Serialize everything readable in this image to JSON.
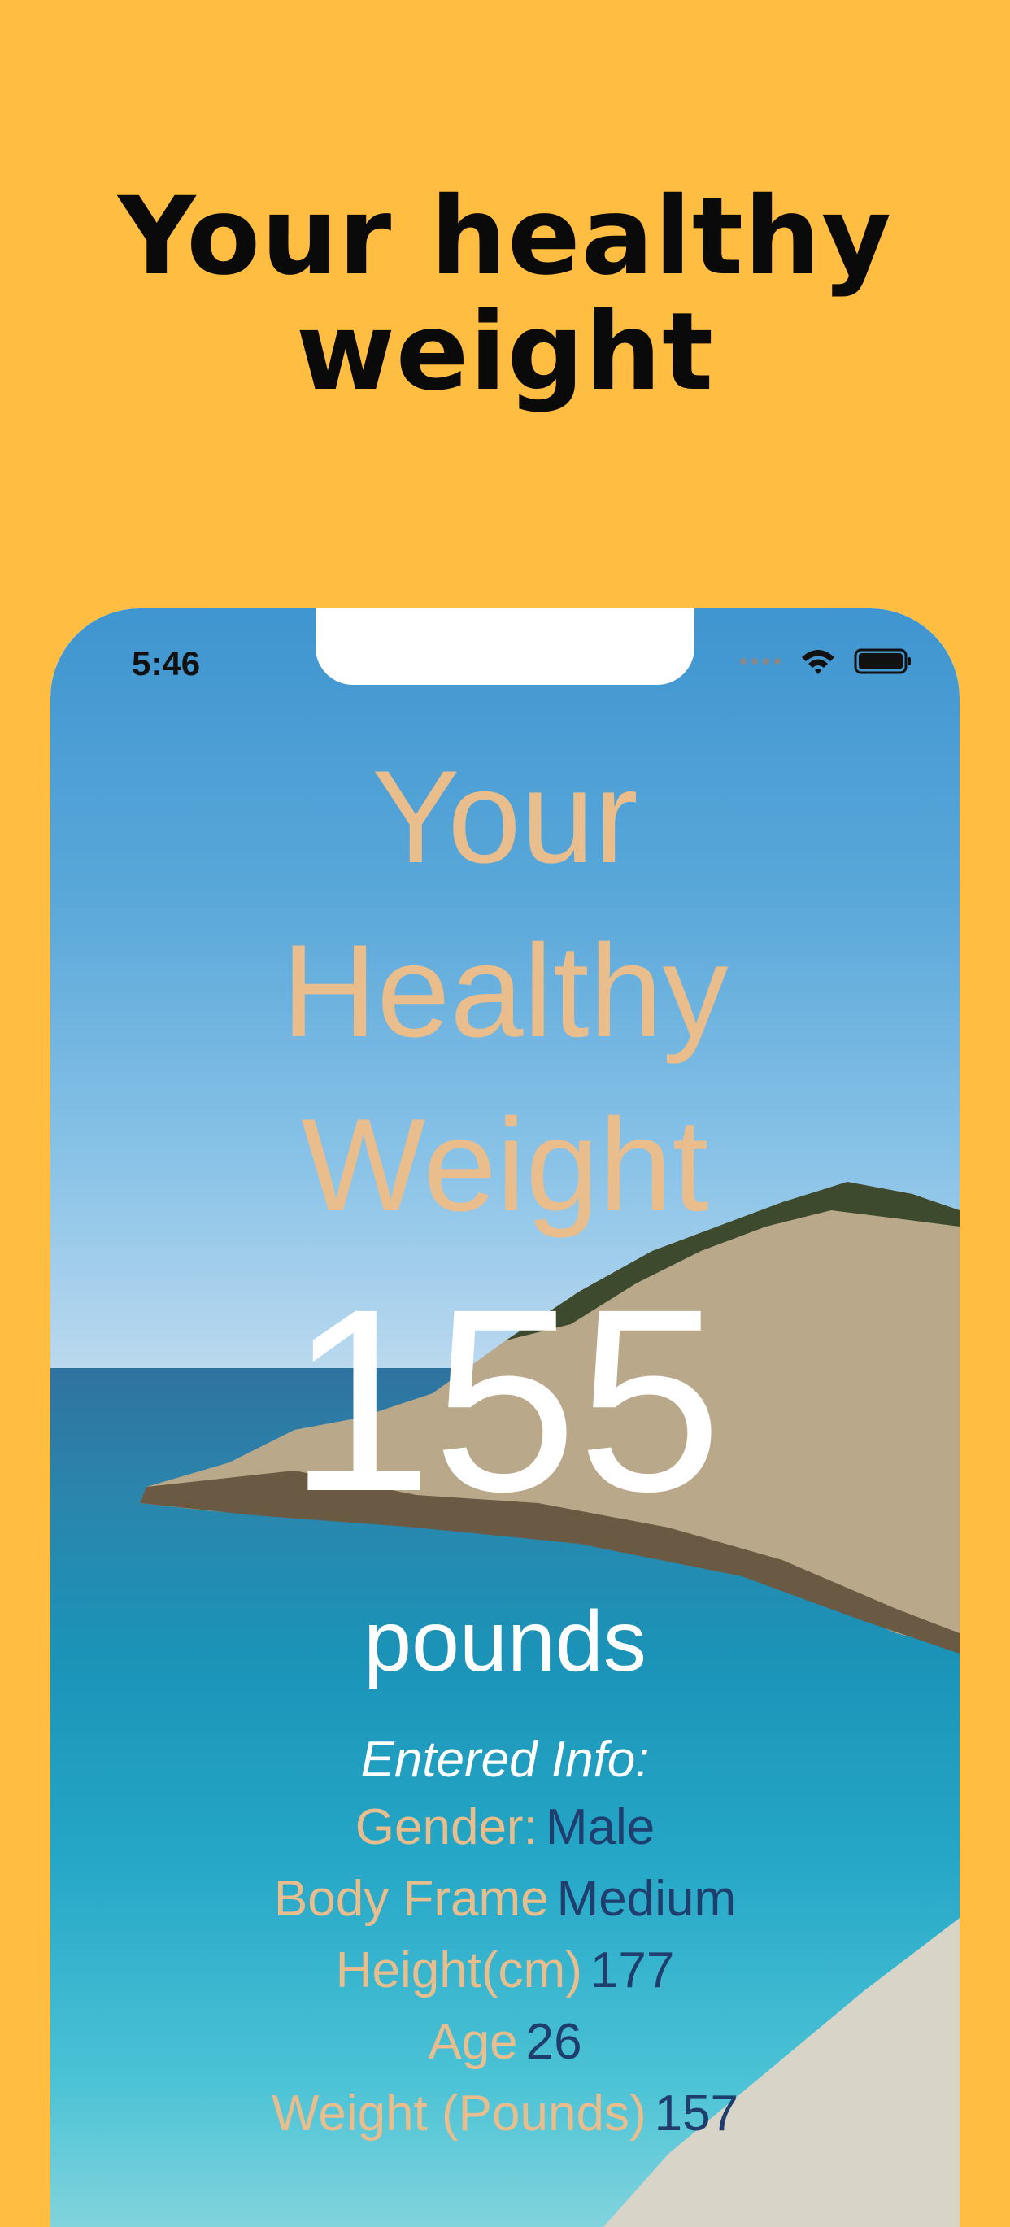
{
  "promo": {
    "title_line1": "Your healthy",
    "title_line2": "weight"
  },
  "status_bar": {
    "time": "5:46"
  },
  "app": {
    "title_line1": "Your",
    "title_line2": "Healthy",
    "title_line3": "Weight",
    "weight_value": "155",
    "weight_unit": "pounds",
    "info_heading": "Entered Info:",
    "info": [
      {
        "label": "Gender:",
        "value": "Male"
      },
      {
        "label": "Body Frame",
        "value": "Medium"
      },
      {
        "label": "Height(cm)",
        "value": "177"
      },
      {
        "label": "Age",
        "value": "26"
      },
      {
        "label": "Weight (Pounds)",
        "value": "157"
      }
    ]
  },
  "colors": {
    "background": "#FFBD42",
    "title_accent": "#E9BD8C",
    "value_color": "#1F3E6E"
  },
  "icons": [
    "signal-icon",
    "wifi-icon",
    "battery-icon"
  ]
}
